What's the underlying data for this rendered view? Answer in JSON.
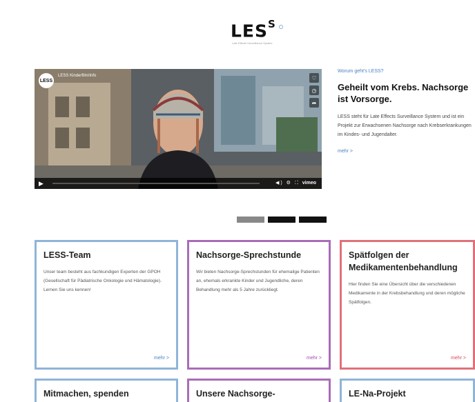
{
  "logo": {
    "main": "LES",
    "sup": "S",
    "tagline": "Late Effects Surveillance System"
  },
  "video": {
    "channel_logo": "LESS",
    "title": "LESS Kinderfilm/Info",
    "vendor": "vimeo",
    "controls": [
      "heart-icon",
      "clock-icon",
      "share-icon"
    ],
    "player_icons": [
      "play-icon",
      "volume-icon",
      "settings-icon",
      "fullscreen-icon"
    ]
  },
  "feature": {
    "kicker": "Worum geht's LESS?",
    "title": "Geheilt vom Krebs. Nachsorge ist Vorsorge.",
    "text": "LESS steht für Late Effects Surveillance System und ist ein Projekt zur Erwachsenen Nachsorge nach Krebserkrankungen im Kindes- und Jugendalter.",
    "more": "mehr >"
  },
  "slider": {
    "count": 3,
    "active_index": 0
  },
  "cards": [
    {
      "title": "LESS-Team",
      "text": "Unser team besteht aus fachkundigen Experten der GPOH (Gesellschaft für Pädiatrische Onkologie und Hämatologie). Lernen Sie uns kennen!",
      "more": "mehr >"
    },
    {
      "title": "Nachsorge-Sprechstunde",
      "text": "Wir bieten Nachsorge-Sprechstunden für ehemalige Patienten an, ehemals erkrankte Kinder und Jugendliche, deren Behandlung mehr als 5 Jahre zurückliegt.",
      "more": "mehr >"
    },
    {
      "title": "Spätfolgen der Medikamentenbehandlung",
      "text": "Hier finden Sie eine Übersicht über die verschiedenen Medikamente in der Krebsbehandlung und deren mögliche Spätfolgen.",
      "more": "mehr >"
    },
    {
      "title": "Mitmachen, spenden"
    },
    {
      "title": "Unsere Nachsorge-"
    },
    {
      "title": "LE-Na-Projekt"
    }
  ],
  "colors": {
    "blue": "#8fb4d8",
    "purple": "#a96cb8",
    "red": "#e07079",
    "link": "#4a82bd"
  }
}
